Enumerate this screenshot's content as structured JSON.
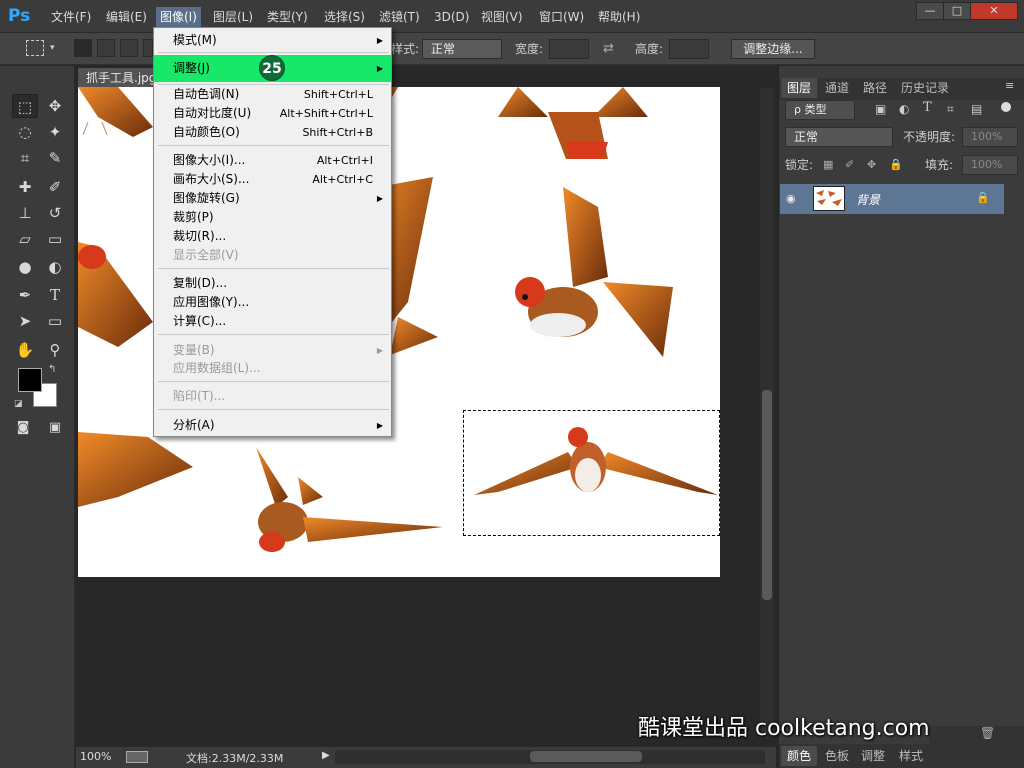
{
  "app": {
    "logo": "Ps"
  },
  "menubar": {
    "items": [
      "文件(F)",
      "编辑(E)",
      "图像(I)",
      "图层(L)",
      "类型(Y)",
      "选择(S)",
      "滤镜(T)",
      "3D(D)",
      "视图(V)",
      "窗口(W)",
      "帮助(H)"
    ],
    "active": "图像(I)",
    "window_buttons": [
      "—",
      "□",
      "✕"
    ]
  },
  "options_bar": {
    "style_label": "样式:",
    "style_value": "正常",
    "width_label": "宽度:",
    "height_label": "高度:",
    "refine_edge": "调整边缘..."
  },
  "document": {
    "tab_title": "抓手工具.jpg",
    "zoom": "100%",
    "doc_info": "文档:2.33M/2.33M"
  },
  "image_menu": {
    "items": [
      {
        "label": "模式(M)",
        "submenu": true
      },
      {
        "label": "调整(J)",
        "submenu": true,
        "highlighted": true
      },
      {
        "label": "自动色调(N)",
        "shortcut": "Shift+Ctrl+L"
      },
      {
        "label": "自动对比度(U)",
        "shortcut": "Alt+Shift+Ctrl+L"
      },
      {
        "label": "自动颜色(O)",
        "shortcut": "Shift+Ctrl+B"
      },
      {
        "label": "图像大小(I)...",
        "shortcut": "Alt+Ctrl+I"
      },
      {
        "label": "画布大小(S)...",
        "shortcut": "Alt+Ctrl+C"
      },
      {
        "label": "图像旋转(G)",
        "submenu": true
      },
      {
        "label": "裁剪(P)"
      },
      {
        "label": "裁切(R)..."
      },
      {
        "label": "显示全部(V)",
        "disabled": true
      },
      {
        "label": "复制(D)..."
      },
      {
        "label": "应用图像(Y)..."
      },
      {
        "label": "计算(C)..."
      },
      {
        "label": "变量(B)",
        "submenu": true,
        "disabled": true
      },
      {
        "label": "应用数据组(L)...",
        "disabled": true
      },
      {
        "label": "陷印(T)...",
        "disabled": true
      },
      {
        "label": "分析(A)",
        "submenu": true
      }
    ]
  },
  "step_badge": "25",
  "layers_panel": {
    "tabs": [
      "图层",
      "通道",
      "路径",
      "历史记录"
    ],
    "filter_label": "ρ 类型",
    "blend_mode": "正常",
    "opacity_label": "不透明度:",
    "opacity_value": "100%",
    "lock_label": "锁定:",
    "fill_label": "填充:",
    "fill_value": "100%",
    "layer_name": "背景"
  },
  "bottom_panel": {
    "tabs": [
      "颜色",
      "色板",
      "调整",
      "样式"
    ]
  },
  "watermark": "酷课堂出品 coolketang.com",
  "colors": {
    "menu_highlight": "#17e869",
    "badge": "#0f6b3a",
    "layer_selected": "#5c7694",
    "foreground": "#000000",
    "background": "#ffffff"
  }
}
